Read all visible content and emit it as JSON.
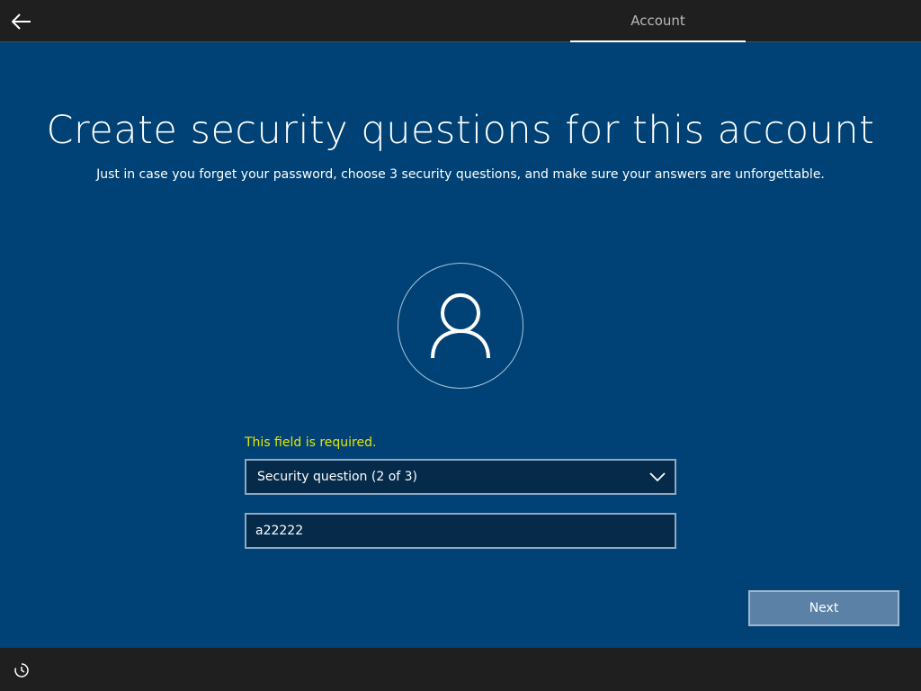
{
  "header": {
    "back_icon": "arrow-left-icon",
    "tab_label": "Account"
  },
  "main": {
    "title": "Create security questions for this account",
    "subtitle": "Just in case you forget your password, choose 3 security questions, and make sure your answers are unforgettable.",
    "avatar_icon": "user-icon",
    "error_message": "This field is required.",
    "question_dropdown": {
      "selected": "Security question (2 of 3)",
      "icon": "chevron-down-icon"
    },
    "answer_field": {
      "value": "a22222",
      "placeholder": ""
    },
    "next_label": "Next"
  },
  "footer": {
    "ease_icon": "ease-of-access-icon"
  },
  "colors": {
    "background": "#004275",
    "bar": "#1f1f1f",
    "error": "#e6e600",
    "button": "#5b81a6"
  }
}
